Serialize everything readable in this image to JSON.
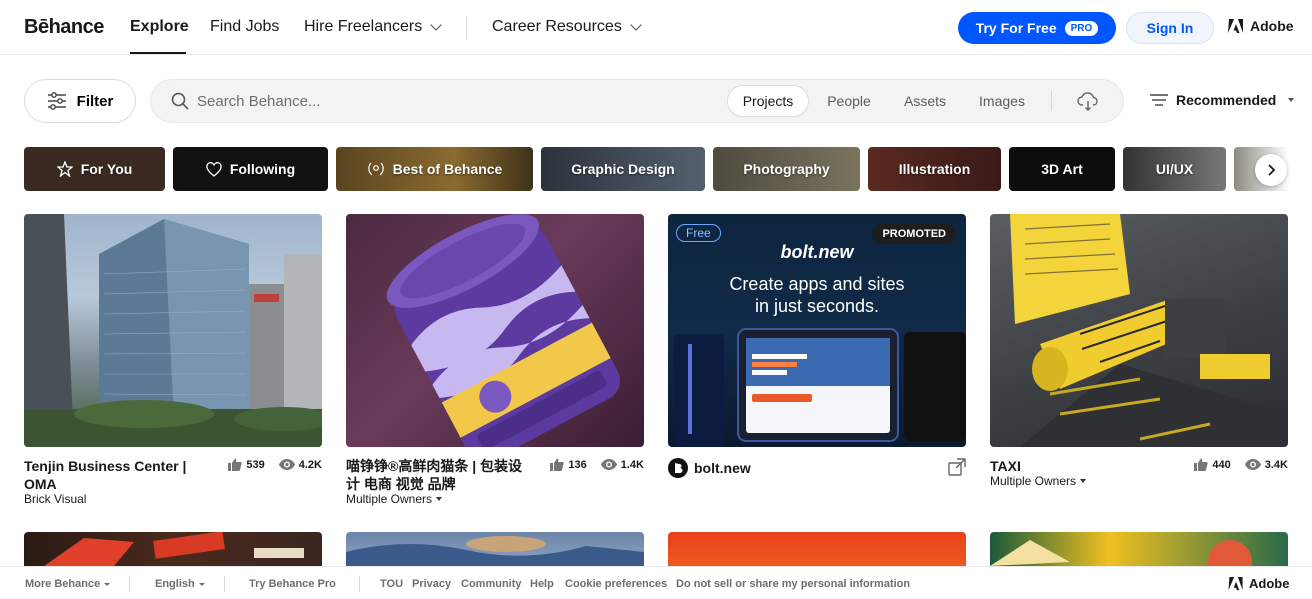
{
  "nav": {
    "logo": "Bēhance",
    "items": [
      {
        "label": "Explore"
      },
      {
        "label": "Find Jobs"
      },
      {
        "label": "Hire Freelancers"
      },
      {
        "label": "Career Resources"
      }
    ],
    "try_label": "Try For Free",
    "pro_badge": "PRO",
    "signin_label": "Sign In",
    "adobe_label": "Adobe"
  },
  "search": {
    "filter_label": "Filter",
    "placeholder": "Search Behance...",
    "segments": [
      "Projects",
      "People",
      "Assets",
      "Images"
    ],
    "active_segment": "Projects",
    "sort_label": "Recommended"
  },
  "categories": [
    {
      "label": "For You",
      "icon": "star-icon",
      "color": "#3a2a22"
    },
    {
      "label": "Following",
      "icon": "heart-icon",
      "color": "#111111"
    },
    {
      "label": "Best of Behance",
      "icon": "laurel-icon",
      "color": "#6b5326"
    },
    {
      "label": "Graphic Design",
      "icon": "",
      "color": "#3d4450"
    },
    {
      "label": "Photography",
      "icon": "",
      "color": "#5e5a4e"
    },
    {
      "label": "Illustration",
      "icon": "",
      "color": "#4a2a24"
    },
    {
      "label": "3D Art",
      "icon": "",
      "color": "#0f0f0f"
    },
    {
      "label": "UI/UX",
      "icon": "",
      "color": "#575757"
    }
  ],
  "projects": [
    {
      "title": "Tenjin Business Center | OMA",
      "owner": "Brick Visual",
      "likes": "539",
      "views": "4.2K"
    },
    {
      "title": "喵铮铮®高鲜肉猫条 | 包装设计 电商 视觉 品牌",
      "owner": "Multiple Owners",
      "likes": "136",
      "views": "1.4K"
    },
    {
      "title": "bolt.new",
      "badge_free": "Free",
      "badge_promoted": "PROMOTED",
      "brand": "bolt.new",
      "headline_1": "Create apps and sites",
      "headline_2": "in just seconds."
    },
    {
      "title": "TAXI",
      "owner": "Multiple Owners",
      "likes": "440",
      "views": "3.4K"
    }
  ],
  "footer": {
    "more": "More Behance",
    "language": "English",
    "pro": "Try Behance Pro",
    "links": [
      "TOU",
      "Privacy",
      "Community",
      "Help",
      "Cookie preferences",
      "Do not sell or share my personal information"
    ],
    "adobe": "Adobe"
  },
  "colors": {
    "brand_blue": "#0057ff",
    "signin_bg": "#f0f5ff",
    "text": "#191919",
    "muted": "#6e6e6e"
  }
}
